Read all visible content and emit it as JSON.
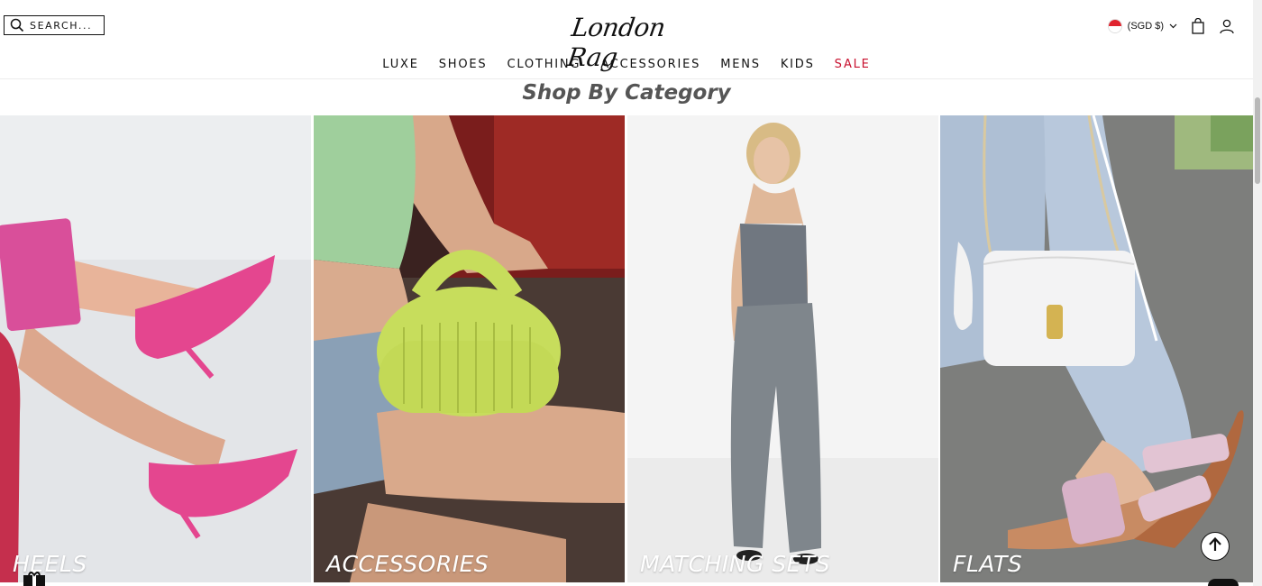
{
  "header": {
    "search_label": "SEARCH...",
    "logo_text": "London Rag",
    "currency": "(SGD $)",
    "currency_flag": "singapore-flag"
  },
  "nav": {
    "items": [
      "LUXE",
      "SHOES",
      "CLOTHING",
      "ACCESSORIES",
      "MENS",
      "KIDS",
      "SALE"
    ]
  },
  "section": {
    "title": "Shop By Category"
  },
  "categories": [
    {
      "label": "HEELS"
    },
    {
      "label": "ACCESSORIES"
    },
    {
      "label": "MATCHING SETS"
    },
    {
      "label": "FLATS"
    }
  ],
  "colors": {
    "sale": "#c8102e",
    "title": "#555555"
  },
  "icons": {
    "search": "search-icon",
    "cart": "bag-icon",
    "account": "user-icon",
    "back_to_top": "arrow-up-icon"
  }
}
